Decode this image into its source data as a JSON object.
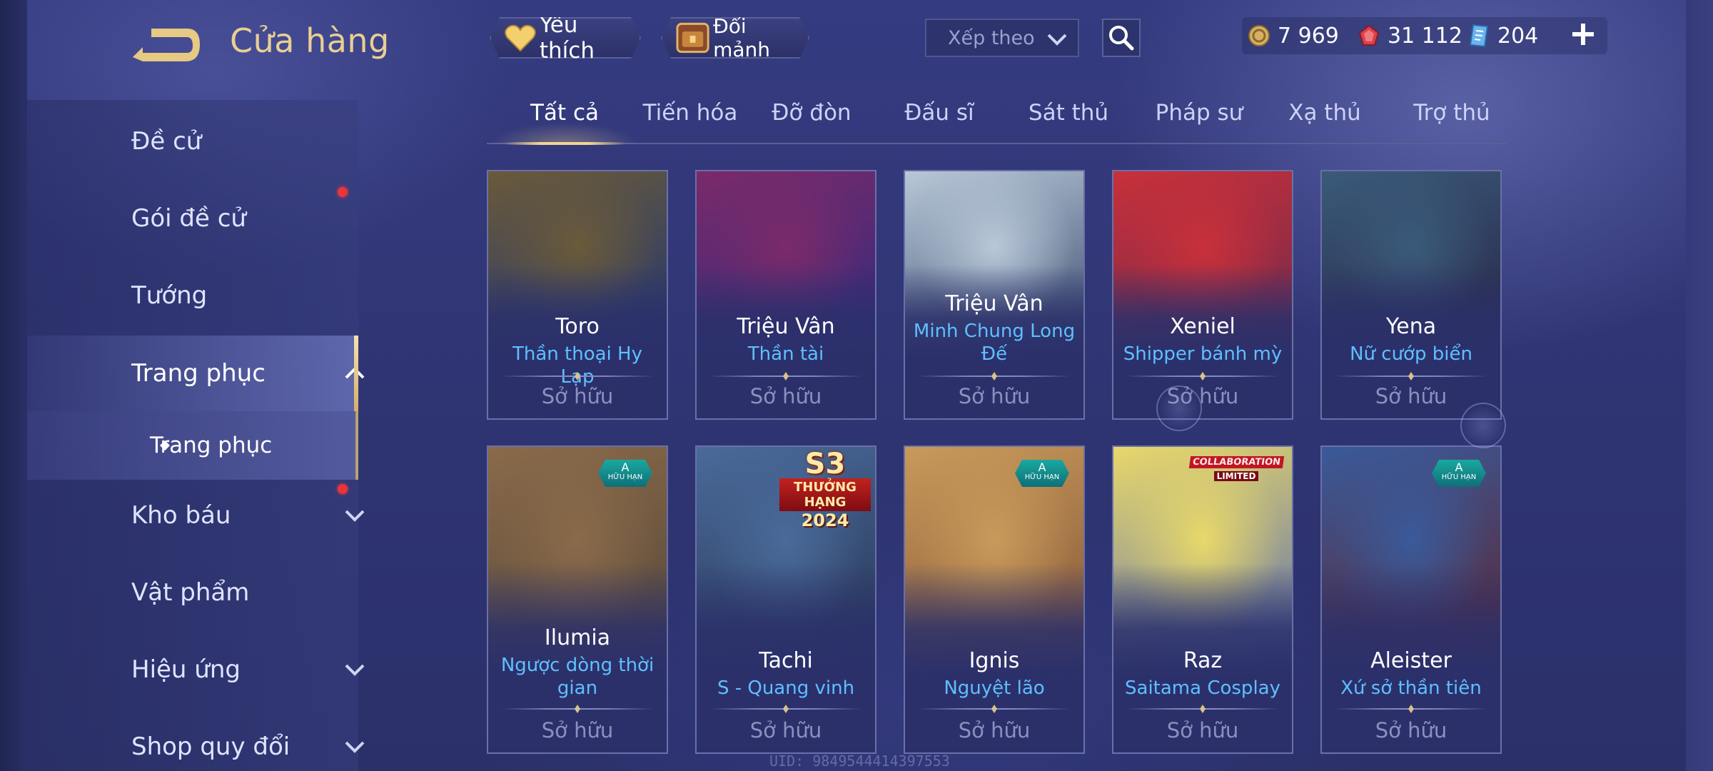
{
  "header": {
    "title": "Cửa hàng",
    "favorites_label": "Yêu thích",
    "exchange_label": "Đổi mảnh",
    "sort_placeholder": "Xếp theo"
  },
  "currencies": [
    {
      "icon": "gold-coin-icon",
      "value": "7 969"
    },
    {
      "icon": "red-gem-icon",
      "value": "31 112"
    },
    {
      "icon": "voucher-icon",
      "value": "204"
    }
  ],
  "sidebar": {
    "items": [
      {
        "label": "Đề cử"
      },
      {
        "label": "Gói đề cử"
      },
      {
        "label": "Tướng"
      },
      {
        "label": "Trang phục"
      },
      {
        "label": "Kho báu"
      },
      {
        "label": "Vật phẩm"
      },
      {
        "label": "Hiệu ứng"
      },
      {
        "label": "Shop quy đổi"
      }
    ],
    "sub_item": "Trang phục"
  },
  "tabs": [
    "Tất cả",
    "Tiến hóa",
    "Đỡ đòn",
    "Đấu sĩ",
    "Sát thủ",
    "Pháp sư",
    "Xạ thủ",
    "Trợ thủ"
  ],
  "cards": [
    {
      "hero": "Toro",
      "skin": "Thần thoại Hy Lạp",
      "status": "Sở hữu",
      "color_a": "#6a5a3a",
      "color_b": "#2a3a6a"
    },
    {
      "hero": "Triệu Vân",
      "skin": "Thần tài",
      "status": "Sở hữu",
      "color_a": "#7a2a6a",
      "color_b": "#3a2a7a"
    },
    {
      "hero": "Triệu Vân",
      "skin": "Minh Chung Long Đế",
      "status": "Sở hữu",
      "color_a": "#b8c8d8",
      "color_b": "#4a5a7a"
    },
    {
      "hero": "Xeniel",
      "skin": "Shipper bánh mỳ",
      "status": "Sở hữu",
      "color_a": "#c8303a",
      "color_b": "#7a2a4a"
    },
    {
      "hero": "Yena",
      "skin": "Nữ cướp biển",
      "status": "Sở hữu",
      "color_a": "#3a5a7a",
      "color_b": "#2a2a4a"
    },
    {
      "hero": "Ilumia",
      "skin": "Ngược dòng thời gian",
      "status": "Sở hữu",
      "badge": "A",
      "badge_sub": "HỮU HẠN",
      "color_a": "#8a6a4a",
      "color_b": "#5a4a3a"
    },
    {
      "hero": "Tachi",
      "skin": "S - Quang vinh",
      "status": "Sở hữu",
      "badge_s3": "S3",
      "badge_s3_rank": "THƯỞNG HẠNG",
      "badge_s3_year": "2024",
      "color_a": "#4a6a9a",
      "color_b": "#2a3a5a"
    },
    {
      "hero": "Ignis",
      "skin": "Nguyệt lão",
      "status": "Sở hữu",
      "badge": "A",
      "badge_sub": "HỮU HẠN",
      "color_a": "#c89a5a",
      "color_b": "#8a5a3a"
    },
    {
      "hero": "Raz",
      "skin": "Saitama Cosplay",
      "status": "Sở hữu",
      "badge_collab": "COLLABORATION",
      "badge_collab_sub": "LIMITED",
      "color_a": "#e8d86a",
      "color_b": "#6a7aa8"
    },
    {
      "hero": "Aleister",
      "skin": "Xứ sở thần tiên",
      "status": "Sở hữu",
      "badge": "A",
      "badge_sub": "HỮU HẠN",
      "color_a": "#3a5a9a",
      "color_b": "#5a2a3a"
    }
  ],
  "uid": "UID: 9849544414397553",
  "colors": {
    "title_gold": "#e8cf93",
    "skin_blue": "#5fbfff",
    "background": "#2f3572",
    "notification_red": "#e8353a"
  }
}
